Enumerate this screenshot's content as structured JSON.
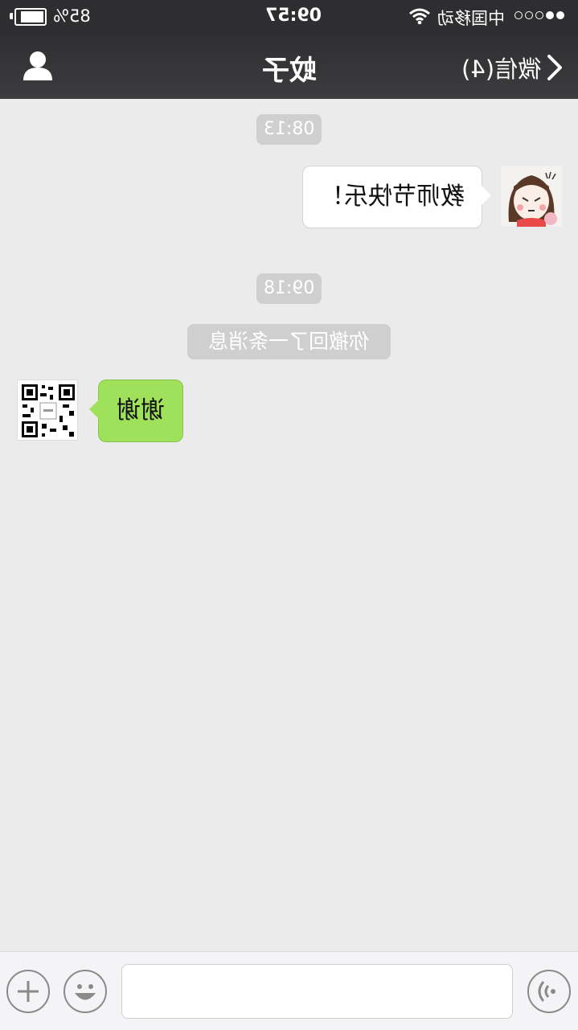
{
  "status": {
    "battery": "85%",
    "time": "09:57",
    "carrier": "中国移动",
    "battery_level": 0.85,
    "signal_bars_filled": 2,
    "signal_bars_total": 5
  },
  "nav": {
    "back_label": "微信(4)",
    "title": "蚊子"
  },
  "messages": {
    "time1": "08:13",
    "msg1": "教师节快乐！",
    "time2": "09:18",
    "recall": "你撤回了一条消息",
    "msg2": "谢谢"
  },
  "colors": {
    "bar": "#2e2e30",
    "chat_bg": "#ebebeb",
    "green_bubble": "#9fe15a",
    "time_pill": "#cfcfcf"
  },
  "icons": [
    "chevron-left-icon",
    "contact-icon",
    "plus-icon",
    "emoji-icon",
    "voice-icon",
    "wifi-icon",
    "battery-icon"
  ]
}
